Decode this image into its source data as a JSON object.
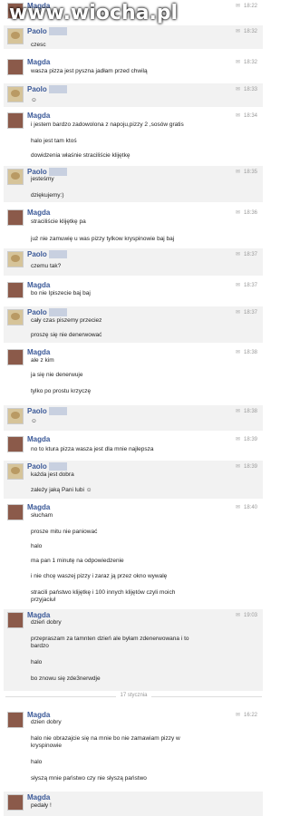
{
  "watermark": "www.wiocha.pl",
  "date_separator": "17 stycznia",
  "messages": [
    {
      "sender": "Magda",
      "time": "18:22",
      "lines": []
    },
    {
      "sender": "Paolo",
      "time": "18:32",
      "lines": [
        "czesc"
      ]
    },
    {
      "sender": "Magda",
      "time": "18:32",
      "lines": [
        "wasza pizza jest pyszna jadłam przed chwilą"
      ]
    },
    {
      "sender": "Paolo",
      "time": "18:33",
      "lines": [
        "☺"
      ]
    },
    {
      "sender": "Magda",
      "time": "18:34",
      "lines": [
        "i jestem bardzo zadowolona z napoju,pizzy 2 ,sosów gratis",
        "halo jest tam ktoś",
        "dowidzenia właśnie straciliście klijętkę"
      ]
    },
    {
      "sender": "Paolo",
      "time": "18:35",
      "lines": [
        "jesteśmy",
        "dziękujemy:)"
      ]
    },
    {
      "sender": "Magda",
      "time": "18:36",
      "lines": [
        "straciliście klijętkę pa",
        "już nie zamuwię u was pizzy tylkow kryspinowie baj baj"
      ]
    },
    {
      "sender": "Paolo",
      "time": "18:37",
      "lines": [
        "czemu tak?"
      ]
    },
    {
      "sender": "Magda",
      "time": "18:37",
      "lines": [
        "bo nie Ipiszecie baj baj"
      ]
    },
    {
      "sender": "Paolo",
      "time": "18:37",
      "lines": [
        "cały czas piszemy przeciez",
        "proszę się nie denerwować"
      ]
    },
    {
      "sender": "Magda",
      "time": "18:38",
      "lines": [
        "ale z kim",
        "ja się nie denerwuje",
        "tylko po prostu krzyczę"
      ]
    },
    {
      "sender": "Paolo",
      "time": "18:38",
      "lines": [
        "☺"
      ]
    },
    {
      "sender": "Magda",
      "time": "18:39",
      "lines": [
        "no to ktura pizza wasza jest dla mnie najlepsza"
      ]
    },
    {
      "sender": "Paolo",
      "time": "18:39",
      "lines": [
        "każda jest dobra",
        "zależy jaką Pani lubi ☺"
      ]
    },
    {
      "sender": "Magda",
      "time": "18:40",
      "lines": [
        "słucham",
        "prosze mitu nie paniować",
        "halo",
        "ma pan 1 minutę na odpowiedzenie",
        "i nie chcę waszej pizzy i zaraz ją przez okno wywalę",
        "stracili państwo klijętkę i 100 innych klijętów czyli moich",
        "przyjaciuł"
      ]
    },
    {
      "sender": "Magda",
      "time": "19:03",
      "lines": [
        "dzień dobry",
        "przepraszam za tamnten dzień ale byłam zdenerwowana i to",
        "bardzo",
        "halo",
        "bo znowu się zde3nerwdje"
      ]
    },
    {
      "sender": "Magda",
      "time": "16:22",
      "lines": [
        "dzien dobry",
        "halo nie obrazajcie się na mnie bo nie zamawiam pizzy w",
        "kryspinowie",
        "halo",
        "słyszą mnie państwo czy nie słyszą państwo"
      ]
    },
    {
      "sender": "Magda",
      "time": "",
      "lines": [
        "pedały !"
      ]
    }
  ]
}
